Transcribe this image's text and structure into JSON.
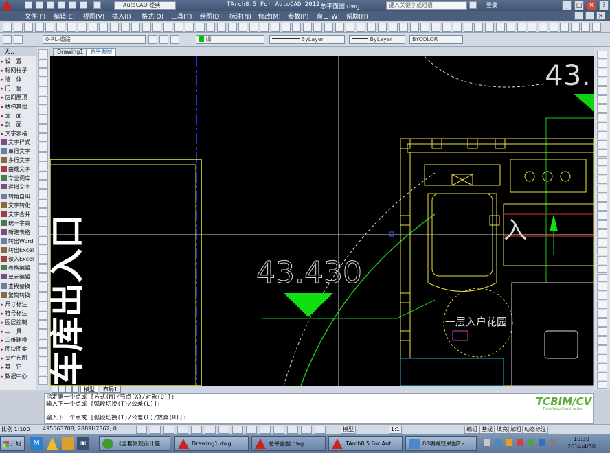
{
  "window": {
    "title": "TArch8.5 For AutoCAD 2012",
    "file_title": "总平面图.dwg",
    "workspace": "AutoCAD 经典",
    "search_placeholder": "键入关键字或短语",
    "login": "登录"
  },
  "menu": [
    "文件(F)",
    "编辑(E)",
    "视图(V)",
    "插入(I)",
    "格式(O)",
    "工具(T)",
    "绘图(D)",
    "标注(N)",
    "修改(M)",
    "参数(P)",
    "窗口(W)",
    "帮助(H)"
  ],
  "toolbar": {
    "layer_name": "0-RL-道路",
    "color": "绿",
    "linetype": "ByLayer",
    "lineweight": "ByLayer",
    "plotstyle": "BYCOLOR"
  },
  "palette": {
    "title": "天..",
    "items": [
      "设　置",
      "轴网柱子",
      "墙　体",
      "门　窗",
      "房间屋顶",
      "楼梯其他",
      "立　面",
      "剖　面",
      "文字表格",
      "文字样式",
      "单行文字",
      "多行文字",
      "曲线文字",
      "专业词库",
      "递增文字",
      "转角自纠",
      "文字转化",
      "文字合并",
      "统一字高",
      "新建表格",
      "转出Word",
      "转出Excel",
      "读入Excel",
      "表格编辑",
      "单元编辑",
      "查找替换",
      "繁简转换",
      "尺寸标注",
      "符号标注",
      "图层控制",
      "工　具",
      "三维建模",
      "图块图案",
      "文件布图",
      "其　它",
      "数据中心"
    ]
  },
  "doc_tabs": [
    "Drawing1",
    "总平面图"
  ],
  "layout_tabs": [
    "模型",
    "布局1"
  ],
  "drawing": {
    "elevation_top": "43.",
    "elevation_main": "43.430",
    "entrance_label": "车库出入口",
    "garden_label": "一层入户花园",
    "mark": "入"
  },
  "command_lines": [
    "指定第一个点或 [方式(M)/节点(X)/对象(O)]:",
    "输入下一个点或 [弧段切换(T)/公差(L)]:",
    "",
    "输入下一个点或 [弧段切换(T)/公差(L)/放弃(U)]:"
  ],
  "logo": {
    "text": "TCBIM/CV",
    "sub": "Tianzheng Construction"
  },
  "status": {
    "scale": "比例 1:100",
    "coords": "495563708, 2889H7362, 0",
    "right_buttons": [
      "模型",
      "编组",
      "基线",
      "填充",
      "加粗",
      "动态标注"
    ],
    "anno_scale": "1:1"
  },
  "taskbar": {
    "start": "开始",
    "tasks": [
      "《全套景观设计施...",
      "Drawing1.dwg",
      "总平面图.dwg",
      "TArch8.5 For Aut...",
      "08明殿效果图2 -..."
    ],
    "time": "10:39",
    "date": "2014/4/30"
  }
}
